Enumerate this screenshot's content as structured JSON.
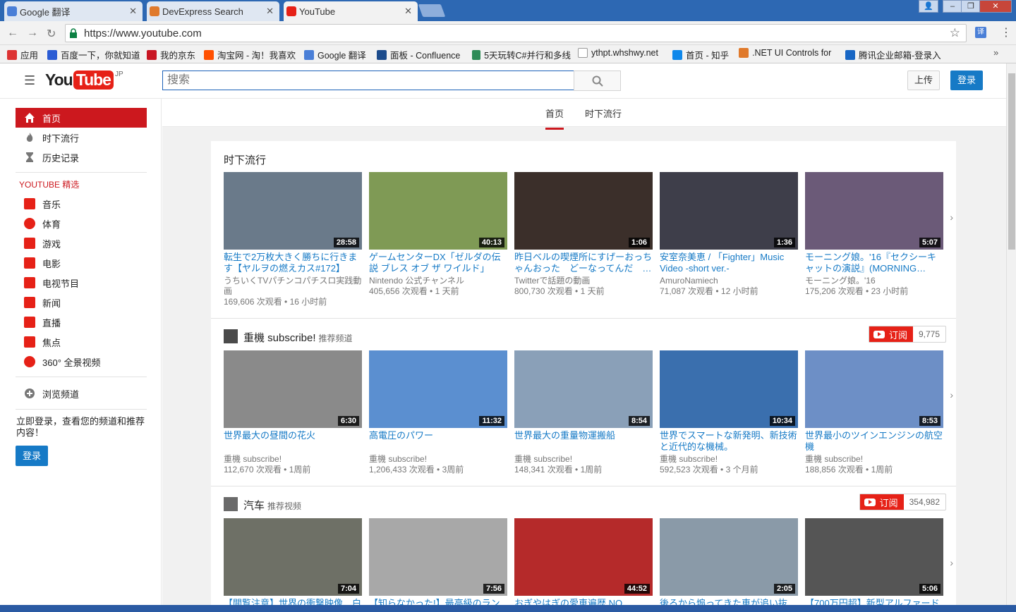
{
  "browser": {
    "tabs": [
      {
        "title": "Google 翻译",
        "favicon_color": "#4a7fd7"
      },
      {
        "title": "DevExpress Search",
        "favicon_color": "#e07a2c"
      },
      {
        "title": "YouTube",
        "favicon_color": "#e62117"
      }
    ],
    "url": "https://www.youtube.com",
    "bookmarks": [
      {
        "label": "应用",
        "color": "#d33"
      },
      {
        "label": "百度一下，你就知道",
        "color": "#2b5cd4"
      },
      {
        "label": "我的京东",
        "color": "#c81623"
      },
      {
        "label": "淘宝网 - 淘！我喜欢",
        "color": "#ff5000"
      },
      {
        "label": "Google 翻译",
        "color": "#4a7fd7"
      },
      {
        "label": "面板 - Confluence",
        "color": "#1c4b8c"
      },
      {
        "label": "5天玩转C#并行和多线",
        "color": "#2e8b57"
      },
      {
        "label": "ythpt.whshwy.net",
        "color": "#999"
      },
      {
        "label": "首页 - 知乎",
        "color": "#0f88eb"
      },
      {
        "label": ".NET UI Controls for",
        "color": "#e07a2c"
      },
      {
        "label": "腾讯企业邮箱-登录入",
        "color": "#1766c4"
      }
    ]
  },
  "header": {
    "logo_you": "You",
    "logo_tube": "Tube",
    "logo_region": "JP",
    "search_placeholder": "搜索",
    "upload_label": "上传",
    "signin_label": "登录"
  },
  "guide": {
    "main_items": [
      {
        "label": "首页",
        "icon": "home-icon"
      },
      {
        "label": "时下流行",
        "icon": "flame-icon"
      },
      {
        "label": "历史记录",
        "icon": "hourglass-icon"
      }
    ],
    "section_title": "YOUTUBE 精选",
    "best_items": [
      {
        "label": "音乐",
        "icon": "music-icon"
      },
      {
        "label": "体育",
        "icon": "sports-icon"
      },
      {
        "label": "游戏",
        "icon": "gaming-icon"
      },
      {
        "label": "电影",
        "icon": "film-icon"
      },
      {
        "label": "电视节目",
        "icon": "tv-icon"
      },
      {
        "label": "新闻",
        "icon": "news-icon"
      },
      {
        "label": "直播",
        "icon": "live-icon"
      },
      {
        "label": "焦点",
        "icon": "spotlight-icon"
      },
      {
        "label": "360° 全景视频",
        "icon": "360-icon"
      }
    ],
    "browse_label": "浏览频道",
    "signin_prompt": "立即登录，查看您的频道和推荐内容！",
    "signin_button": "登录"
  },
  "main": {
    "tabs": [
      "首页",
      "时下流行"
    ],
    "shelves": [
      {
        "title": "时下流行",
        "suffix": "",
        "videos": [
          {
            "title": "転生で2万枚大きく勝ちに行きます【ヤルヲの燃えカス#172】",
            "channel": "うちいくTVパチンコパチスロ実践動画",
            "meta": "169,606 次观看 • 16 小时前",
            "duration": "28:58",
            "bg": "#6a7a8a"
          },
          {
            "title": "ゲームセンターDX「ゼルダの伝説 ブレス オブ ザ ワイルド」",
            "channel": "Nintendo 公式チャンネル",
            "meta": "405,656 次观看 • 1 天前",
            "duration": "40:13",
            "bg": "#7f9a55"
          },
          {
            "title": "昨日ベルの喫煙所にすげーおっちゃんおった　どーなってんだ　…",
            "channel": "Twitterで話題の動画",
            "meta": "800,730 次观看 • 1 天前",
            "duration": "1:06",
            "bg": "#3b2f2a"
          },
          {
            "title": "安室奈美恵 / 「Fighter」Music Video -short ver.-",
            "channel": "AmuroNamiech",
            "meta": "71,087 次观看 • 12 小时前",
            "duration": "1:36",
            "bg": "#3e3e4a"
          },
          {
            "title": "モーニング娘。'16『セクシーキャットの演説』(MORNING…",
            "channel": "モーニング娘。'16",
            "meta": "175,206 次观看 • 23 小时前",
            "duration": "5:07",
            "bg": "#6b5a78"
          }
        ]
      },
      {
        "title": "重機 subscribe!",
        "suffix": "推荐频道",
        "subscribe": "订阅",
        "subscribers": "9,775",
        "videos": [
          {
            "title": "世界最大の昼間の花火",
            "channel": "重機 subscribe!",
            "meta": "112,670 次观看 • 1周前",
            "duration": "6:30",
            "bg": "#8a8a8a"
          },
          {
            "title": "高電圧のパワー",
            "channel": "重機 subscribe!",
            "meta": "1,206,433 次观看 • 3周前",
            "duration": "11:32",
            "bg": "#5b8fd0"
          },
          {
            "title": "世界最大の重量物運搬船",
            "channel": "重機 subscribe!",
            "meta": "148,341 次观看 • 1周前",
            "duration": "8:54",
            "bg": "#8aa0b8"
          },
          {
            "title": "世界でスマートな新発明、新技術と近代的な機械。",
            "channel": "重機 subscribe!",
            "meta": "592,523 次观看 • 3 个月前",
            "duration": "10:34",
            "bg": "#3a6fae"
          },
          {
            "title": "世界最小のツインエンジンの航空機",
            "channel": "重機 subscribe!",
            "meta": "188,856 次观看 • 1周前",
            "duration": "8:53",
            "bg": "#6d8fc6"
          }
        ]
      },
      {
        "title": "汽车",
        "suffix": "推荐视频",
        "subscribe": "订阅",
        "subscribers": "354,982",
        "videos": [
          {
            "title": "【閲覧注意】世界の衝撃映像　白",
            "duration": "7:04",
            "bg": "#6e7066"
          },
          {
            "title": "【知らなかった!】最高級のラン",
            "duration": "7:56",
            "bg": "#a8a8a8"
          },
          {
            "title": "おぎやはぎの愛車遍歴 NO",
            "duration": "44:52",
            "bg": "#b52a2a"
          },
          {
            "title": "後ろから煽ってきた車が追い抜",
            "duration": "2:05",
            "bg": "#8a9aa8"
          },
          {
            "title": "【700万円超】新型アルファード",
            "duration": "5:06",
            "bg": "#555"
          }
        ]
      }
    ]
  }
}
